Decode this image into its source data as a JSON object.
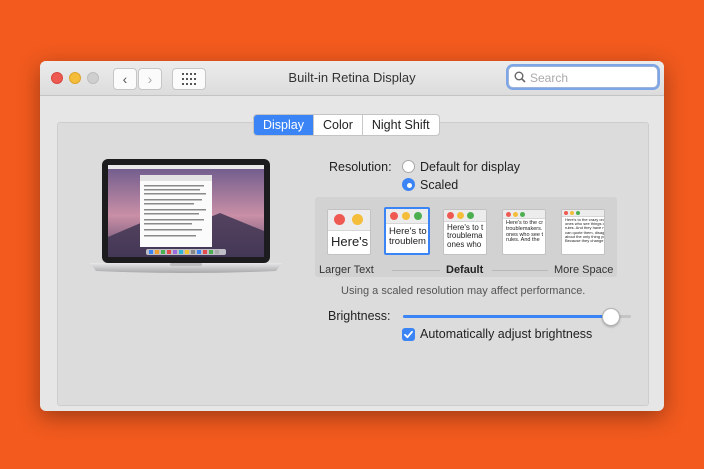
{
  "window": {
    "title": "Built-in Retina Display"
  },
  "toolbar": {
    "back_icon": "chevron-left-icon",
    "forward_icon": "chevron-right-icon",
    "grid_icon": "grid-icon",
    "search_placeholder": "Search"
  },
  "tabs": [
    {
      "label": "Display",
      "active": true
    },
    {
      "label": "Color",
      "active": false
    },
    {
      "label": "Night Shift",
      "active": false
    }
  ],
  "resolution": {
    "label": "Resolution:",
    "options": [
      {
        "label": "Default for display",
        "selected": false
      },
      {
        "label": "Scaled",
        "selected": true
      }
    ]
  },
  "scaling": {
    "thumbs": [
      {
        "text": "Here's"
      },
      {
        "text": "Here's to\ntroublem"
      },
      {
        "text": "Here's to t\ntroublema\nones who"
      },
      {
        "text": "Here's to the cr\ntroublemakers.\nones who see t\nrules. And the"
      },
      {
        "text": "Here's to the crazy one\nones who see things di\nrules. And they have no\ncan quote them, disagr\nabout the only thing yo\nBecause they change th"
      }
    ],
    "selected_index": 1,
    "left_label": "Larger Text",
    "center_label": "Default",
    "right_label": "More Space"
  },
  "performance_note": "Using a scaled resolution may affect performance.",
  "brightness": {
    "label": "Brightness:",
    "level_percent": 91
  },
  "auto_brightness": {
    "label": "Automatically adjust brightness",
    "checked": true
  },
  "colors": {
    "accent": "#3b84f5",
    "background": "#f25a1e",
    "close": "#ee5a52",
    "minimize": "#f4bd3a"
  }
}
